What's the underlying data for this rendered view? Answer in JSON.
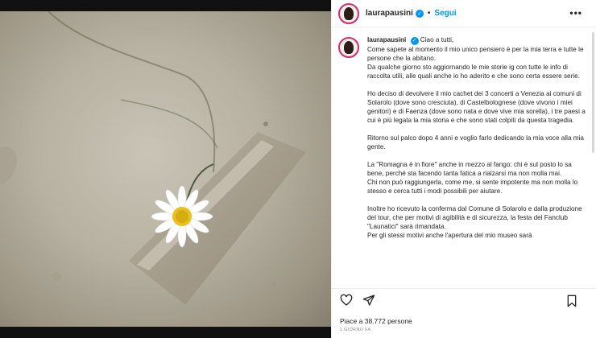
{
  "post": {
    "username": "laurapausini",
    "follow_label": "Segui",
    "dot": "•",
    "more_label": "•••",
    "verified_mark": "✓"
  },
  "caption": {
    "username": "laurapausini",
    "paragraphs": [
      "Ciao a tutti,\nCome sapete al momento il mio unico pensiero è per la mia terra e tutte le persone che la abitano.\nDa qualche giorno sto aggiornando le mie storie ig con tutte le info di raccolta utili, alle quali anche io ho aderito e che sono certa essere serie.",
      "Ho deciso di devolvere il mio cachet dei 3 concerti a Venezia ai comuni di Solarolo (dove sono cresciuta), di Castelbolognese (dove vivono i miei genitori) e di Faenza (dove sono nata e dove vive mia sorella), i tre paesi a cui è più legata la mia storia e che sono stati colpiti da questa tragedia.",
      "Ritorno sul palco dopo 4 anni e voglio farlo dedicando la mia voce alla mia gente.",
      "La \"Romagna è in fiore\" anche in mezzo al fango: chi è sul posto lo sa bene, perché sta facendo tanta fatica a rialzarsi ma non molla mai.\nChi non può raggiungerla, come me, si sente impotente ma non molla lo stesso e cerca tutti i modi possibili per aiutare.",
      "Inoltre ho ricevuto la conferma dal Comune di Solarolo e dalla produzione del tour, che per motivi di agibilità e di sicurezza, la festa del Fanclub \"Launatici\" sarà rimandata.\nPer gli stessi motivi anche l'apertura del mio museo sarà"
    ]
  },
  "footer": {
    "likes": "Piace a 38.772 persone",
    "date": "1 GIORNO FA"
  },
  "icons": {
    "like": "heart-icon",
    "share": "send-icon",
    "save": "bookmark-icon"
  }
}
